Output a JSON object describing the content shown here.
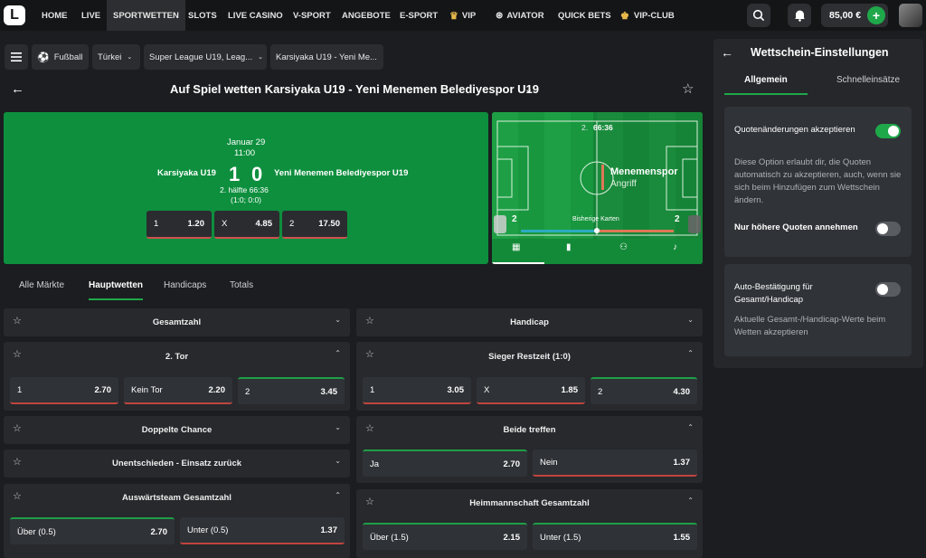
{
  "nav": {
    "items": [
      "HOME",
      "LIVE",
      "SPORTWETTEN",
      "SLOTS",
      "LIVE CASINO",
      "V-SPORT",
      "ANGEBOTE",
      "E-SPORT",
      "VIP",
      "AVIATOR",
      "QUICK BETS",
      "VIP-CLUB"
    ],
    "balance": "85,00 €"
  },
  "breadcrumbs": [
    "Fußball",
    "Türkei",
    "Super League U19, Leag...",
    "Karsiyaka U19 - Yeni Me..."
  ],
  "header": {
    "title": "Auf Spiel wetten Karsiyaka U19 - Yeni Menemen Belediyespor U19"
  },
  "match": {
    "date": "Januar 29",
    "time": "11:00",
    "home": "Karsiyaka U19",
    "away": "Yeni Menemen Belediyespor U19",
    "score_home": "1",
    "score_away": "0",
    "period": "2. hälfte 66:36",
    "detail": "(1:0; 0:0)",
    "odds": [
      {
        "label": "1",
        "value": "1.20"
      },
      {
        "label": "X",
        "value": "4.85"
      },
      {
        "label": "2",
        "value": "17.50"
      }
    ]
  },
  "field": {
    "half": "2.",
    "clock": "66:36",
    "team": "Menemenspor",
    "action": "Angriff",
    "cards_label": "Bisherige Karten",
    "cards_home": "2",
    "cards_away": "2"
  },
  "tabs": [
    "Alle Märkte",
    "Hauptwetten",
    "Handicaps",
    "Totals"
  ],
  "markets_left": [
    {
      "title": "Gesamtzahl"
    },
    {
      "title": "2. Tor",
      "odds": [
        {
          "l": "1",
          "v": "2.70"
        },
        {
          "l": "Kein Tor",
          "v": "2.20"
        },
        {
          "l": "2",
          "v": "3.45"
        }
      ]
    },
    {
      "title": "Doppelte Chance"
    },
    {
      "title": "Unentschieden - Einsatz zurück"
    },
    {
      "title": "Auswärtsteam Gesamtzahl",
      "odds": [
        {
          "l": "Über (0.5)",
          "v": "2.70"
        },
        {
          "l": "Unter (0.5)",
          "v": "1.37"
        }
      ]
    }
  ],
  "markets_right": [
    {
      "title": "Handicap"
    },
    {
      "title": "Sieger Restzeit (1:0)",
      "odds": [
        {
          "l": "1",
          "v": "3.05"
        },
        {
          "l": "X",
          "v": "1.85"
        },
        {
          "l": "2",
          "v": "4.30"
        }
      ]
    },
    {
      "title": "Beide treffen",
      "odds": [
        {
          "l": "Ja",
          "v": "2.70"
        },
        {
          "l": "Nein",
          "v": "1.37"
        }
      ]
    },
    {
      "title": "Heimmannschaft Gesamtzahl",
      "odds": [
        {
          "l": "Über (1.5)",
          "v": "2.15"
        },
        {
          "l": "Unter (1.5)",
          "v": "1.55"
        }
      ]
    }
  ],
  "settings": {
    "title": "Wettschein-Einstellungen",
    "tab_general": "Allgemein",
    "tab_quick": "Schnelleinsätze",
    "opt1_title": "Quotenänderungen akzeptieren",
    "opt1_desc": "Diese Option erlaubt dir, die Quoten automatisch zu akzeptieren, auch, wenn sie sich beim Hinzufügen zum Wettschein ändern.",
    "opt2_title": "Nur höhere Quoten annehmen",
    "opt3_title": "Auto-Bestätigung für Gesamt/Handicap",
    "opt3_desc": "Aktuelle Gesamt-/Handicap-Werte beim Wetten akzeptieren"
  },
  "colors": {
    "accent": "#1fa84a",
    "field": "#0e8f3e",
    "down": "#c0453f"
  }
}
